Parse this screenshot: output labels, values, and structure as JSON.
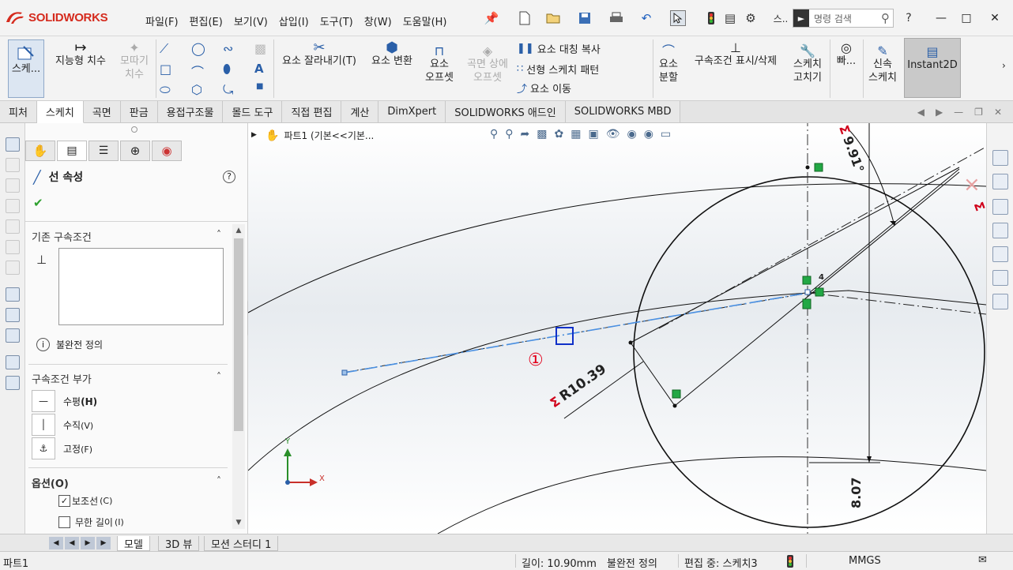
{
  "app": {
    "name": "SOLIDWORKS"
  },
  "menu": [
    "파일(F)",
    "편집(E)",
    "보기(V)",
    "삽입(I)",
    "도구(T)",
    "창(W)",
    "도움말(H)"
  ],
  "toolbar": {
    "more_label": "스..",
    "search_placeholder": "명령 검색",
    "help_label": "?"
  },
  "ribbon": {
    "sketch": "스케...",
    "smart_dim": "지능형 치수",
    "chamfer_1": "모따기",
    "chamfer_2": "치수",
    "trim": "요소 잘라내기(T)",
    "convert": "요소 변환",
    "offset_1": "요소",
    "offset_2": "오프셋",
    "surface_offset_1": "곡면 상에",
    "surface_offset_2": "오프셋",
    "mirror": "요소 대칭 복사",
    "linear_pattern": "선형 스케치 패턴",
    "move": "요소 이동",
    "split_1": "요소",
    "split_2": "분할",
    "show_relations": "구속조건 표시/삭제",
    "repair_1": "스케치",
    "repair_2": "고치기",
    "quick_snap": "빠...",
    "rapid_1": "신속",
    "rapid_2": "스케치",
    "instant2d": "Instant2D"
  },
  "tabs": [
    "피처",
    "스케치",
    "곡면",
    "판금",
    "용접구조물",
    "몰드 도구",
    "직접 편집",
    "계산",
    "DimXpert",
    "SOLIDWORKS 애드인",
    "SOLIDWORKS MBD"
  ],
  "active_tab": "스케치",
  "property_manager": {
    "title": "선 속성",
    "existing_relations_header": "기존 구속조건",
    "status_text": "불완전 정의",
    "add_relations_header": "구속조건 부가",
    "relations": [
      {
        "label": "수평",
        "key": "(H)"
      },
      {
        "label": "수직",
        "key": "(V)"
      },
      {
        "label": "고정",
        "key": "(F)"
      }
    ],
    "options_header": "옵션(O)",
    "options": [
      {
        "label": "보조선",
        "key": "(C)",
        "checked": true
      },
      {
        "label": "무한 길이",
        "key": "(I)",
        "checked": false
      }
    ]
  },
  "graphics": {
    "tree_label": "파트1  (기본<<기본...",
    "dim_radius": "R10.39",
    "dim_angle": "9.91°",
    "dim_vertical": "8.07",
    "callout": "①",
    "relation_count": "4",
    "triad_x": "X",
    "triad_y": "Y",
    "colors": {
      "sketch_line": "#000000",
      "selected_line": "#4a90e2",
      "dimension_sigma": "#d0021b",
      "relation_icon": "#22a845"
    }
  },
  "bottom_tabs": [
    "모델",
    "3D 뷰",
    "모션 스터디 1"
  ],
  "status": {
    "document": "파트1",
    "length": "길이: 10.90mm",
    "definition": "불완전 정의",
    "editing": "편집 중: 스케치3",
    "units": "MMGS"
  }
}
